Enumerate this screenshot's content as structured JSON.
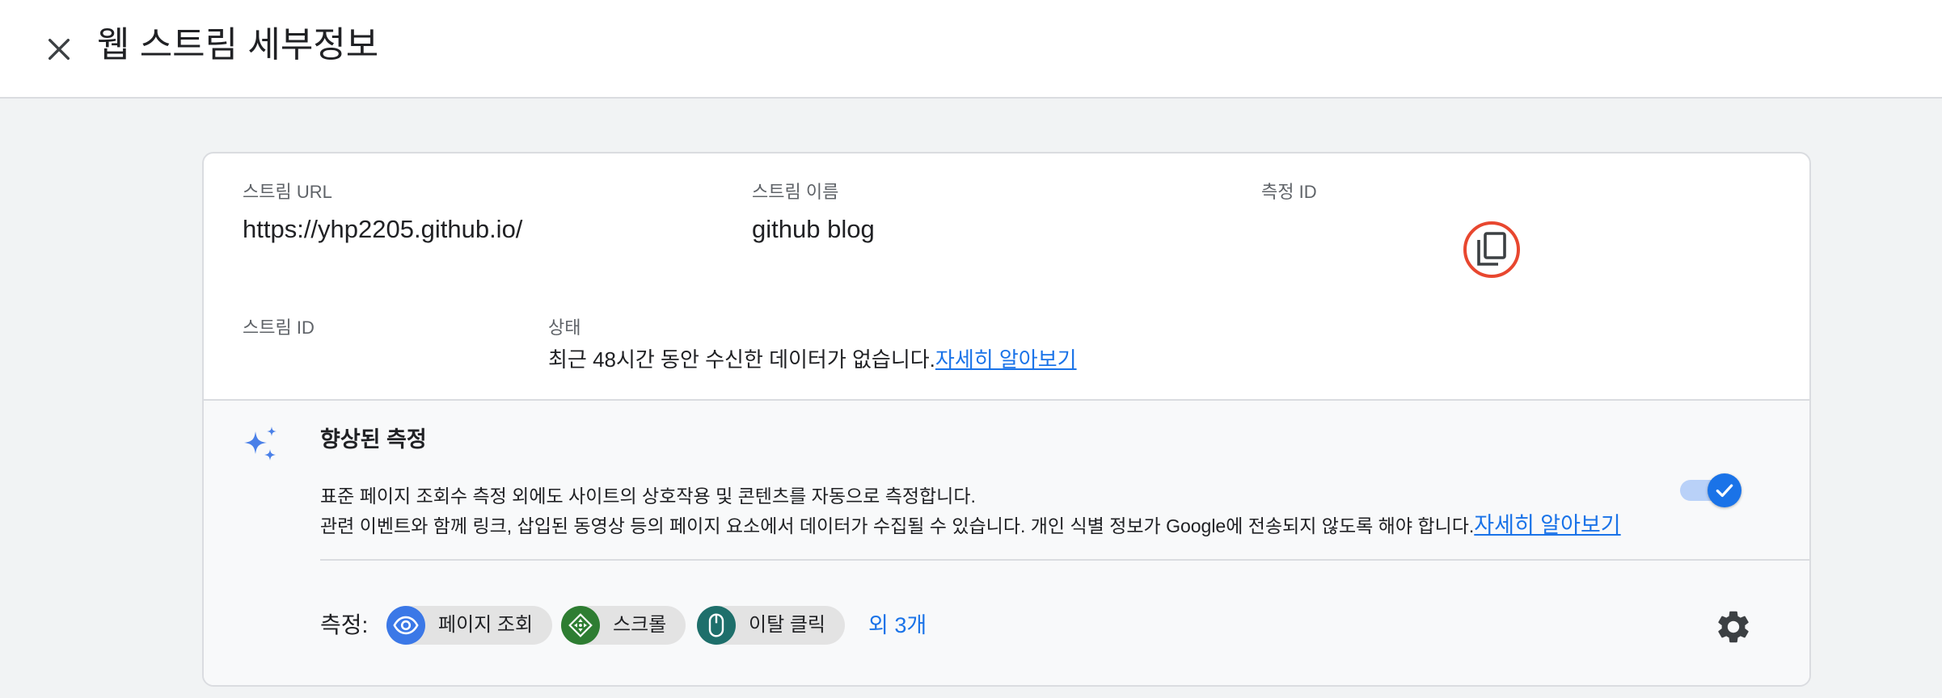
{
  "header": {
    "title": "웹 스트림 세부정보",
    "close_icon": "close-icon"
  },
  "stream": {
    "url_label": "스트림 URL",
    "url_value": "https://yhp2205.github.io/",
    "name_label": "스트림 이름",
    "name_value": "github blog",
    "measurement_id_label": "측정 ID",
    "copy_icon": "copy-icon",
    "stream_id_label": "스트림 ID",
    "status_label": "상태",
    "status_text": "최근 48시간 동안 수신한 데이터가 없습니다.",
    "status_link": "자세히 알아보기"
  },
  "enhanced": {
    "icon": "sparkle-icon",
    "title": "향상된 측정",
    "desc_line1": "표준 페이지 조회수 측정 외에도 사이트의 상호작용 및 콘텐츠를 자동으로 측정합니다.",
    "desc_line2": "관련 이벤트와 함께 링크, 삽입된 동영상 등의 페이지 요소에서 데이터가 수집될 수 있습니다. 개인 식별 정보가 Google에 전송되지 않도록 해야 합니다.",
    "desc_link": "자세히 알아보기",
    "toggle_on": true,
    "measurements_label": "측정:",
    "chips": [
      {
        "label": "페이지 조회",
        "icon": "eye-icon",
        "color": "#3b78e7"
      },
      {
        "label": "스크롤",
        "icon": "scroll-arrows-icon",
        "color": "#2e7d32"
      },
      {
        "label": "이탈 클릭",
        "icon": "mouse-icon",
        "color": "#1e6f6b"
      }
    ],
    "more_link": "외 3개",
    "settings_icon": "gear-icon"
  },
  "colors": {
    "accent": "#1a73e8",
    "copy_highlight": "#e8472f",
    "background": "#f1f3f4"
  }
}
